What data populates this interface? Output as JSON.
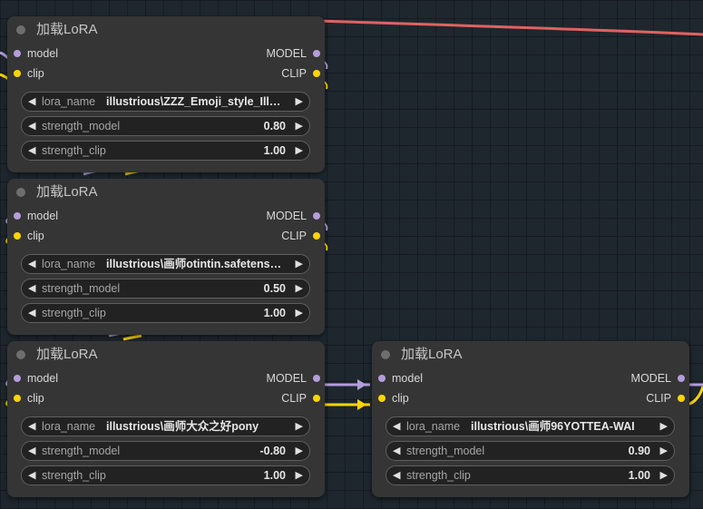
{
  "colors": {
    "model": "#b39ddb",
    "clip": "#ffd500",
    "red_link": "#e06262"
  },
  "icons": {
    "decrement": "left-triangle-icon",
    "increment": "right-triangle-icon",
    "status": "node-dot-icon"
  },
  "slot_labels": {
    "in_model": "model",
    "in_clip": "clip",
    "out_model": "MODEL",
    "out_clip": "CLIP"
  },
  "widget_labels": {
    "lora_name": "lora_name",
    "strength_model": "strength_model",
    "strength_clip": "strength_clip"
  },
  "nodes": [
    {
      "title": "加载LoRA",
      "lora_name": "illustrious\\ZZZ_Emoji_style_Illustrious",
      "strength_model": "0.80",
      "strength_clip": "1.00"
    },
    {
      "title": "加载LoRA",
      "lora_name": "illustrious\\画师otintin.safetensors",
      "strength_model": "0.50",
      "strength_clip": "1.00"
    },
    {
      "title": "加载LoRA",
      "lora_name": "illustrious\\画师大众之好pony",
      "strength_model": "-0.80",
      "strength_clip": "1.00"
    },
    {
      "title": "加载LoRA",
      "lora_name": "illustrious\\画师96YOTTEA-WAI",
      "strength_model": "0.90",
      "strength_clip": "1.00"
    }
  ]
}
